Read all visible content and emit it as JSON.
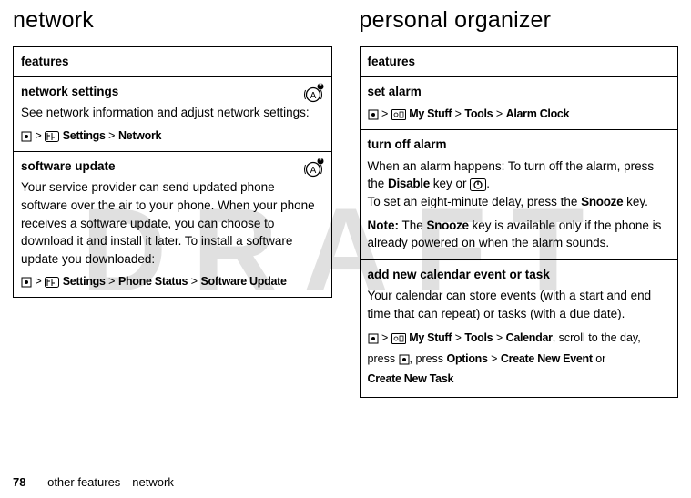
{
  "watermark": "DRAFT",
  "left": {
    "heading": "network",
    "features_label": "features",
    "sections": [
      {
        "title": "network settings",
        "body": "See network information and adjust network settings:",
        "nav_parts": [
          "Settings",
          "Network"
        ],
        "has_provider_icon": true
      },
      {
        "title": "software update",
        "body": "Your service provider can send updated phone software over the air to your phone. When your phone receives a software update, you can choose to download it and install it later. To install a software update you downloaded:",
        "nav_parts": [
          "Settings",
          "Phone Status",
          "Software Update"
        ],
        "has_provider_icon": true
      }
    ]
  },
  "right": {
    "heading": "personal organizer",
    "features_label": "features",
    "alarm_title": "set alarm",
    "alarm_nav": [
      "My Stuff",
      "Tools",
      "Alarm Clock"
    ],
    "turnoff_title": "turn off alarm",
    "turnoff_text1_a": "When an alarm happens: To turn off the alarm, press the ",
    "turnoff_disable": "Disable",
    "turnoff_text1_b": " key or ",
    "turnoff_text1_c": ".",
    "turnoff_text2_a": "To set an eight-minute delay, press the ",
    "turnoff_snooze": "Snooze",
    "turnoff_text2_b": " key.",
    "note_label": "Note:",
    "note_text_a": " The ",
    "note_snooze": "Snooze",
    "note_text_b": " key is available only if the phone is already powered on when the alarm sounds.",
    "cal_title": "add new calendar event or task",
    "cal_body": "Your calendar can store events (with a start and end time that can repeat) or tasks (with a due date).",
    "cal_nav1": [
      "My Stuff",
      "Tools",
      "Calendar"
    ],
    "cal_post1": ", scroll to the day, press ",
    "cal_post2": ", press ",
    "cal_options": "Options",
    "cal_create_event": "Create New Event",
    "cal_or": " or ",
    "cal_create_task": "Create New Task"
  },
  "footer": {
    "page": "78",
    "text": "other features—network"
  }
}
